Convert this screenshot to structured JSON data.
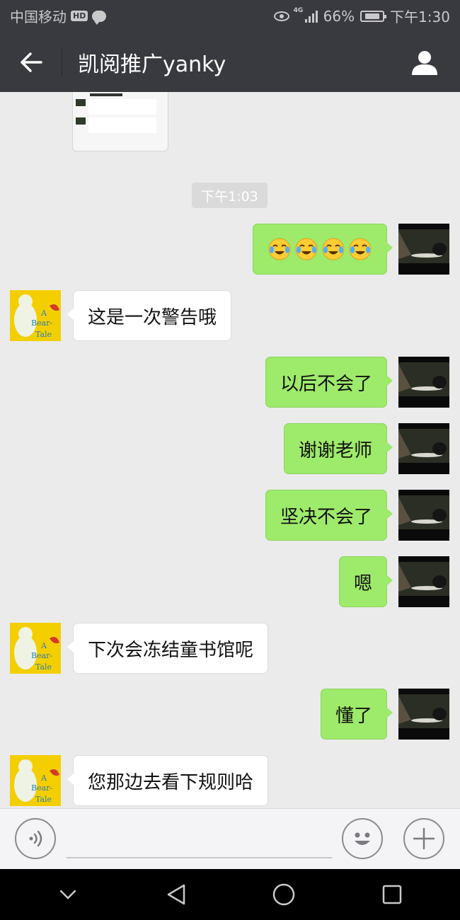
{
  "status_bar": {
    "carrier": "中国移动",
    "hd_badge": "HD",
    "network": "4G",
    "battery_percent": "66%",
    "time": "下午1:30"
  },
  "nav": {
    "title": "凯阅推广yanky"
  },
  "chat": {
    "timestamp": "下午1:03",
    "messages": [
      {
        "sender": "me",
        "type": "emoji",
        "emoji": "😭😭😭😭"
      },
      {
        "sender": "other",
        "text": "这是一次警告哦"
      },
      {
        "sender": "me",
        "text": "以后不会了"
      },
      {
        "sender": "me",
        "text": "谢谢老师"
      },
      {
        "sender": "me",
        "text": "坚决不会了"
      },
      {
        "sender": "me",
        "text": "嗯"
      },
      {
        "sender": "other",
        "text": "下次会冻结童书馆呢"
      },
      {
        "sender": "me",
        "text": "懂了"
      },
      {
        "sender": "other",
        "text": "您那边去看下规则哈"
      }
    ]
  },
  "colors": {
    "header_bg": "#393a3f",
    "chat_bg": "#ebebeb",
    "my_bubble": "#9eea6a",
    "other_bubble": "#ffffff"
  }
}
